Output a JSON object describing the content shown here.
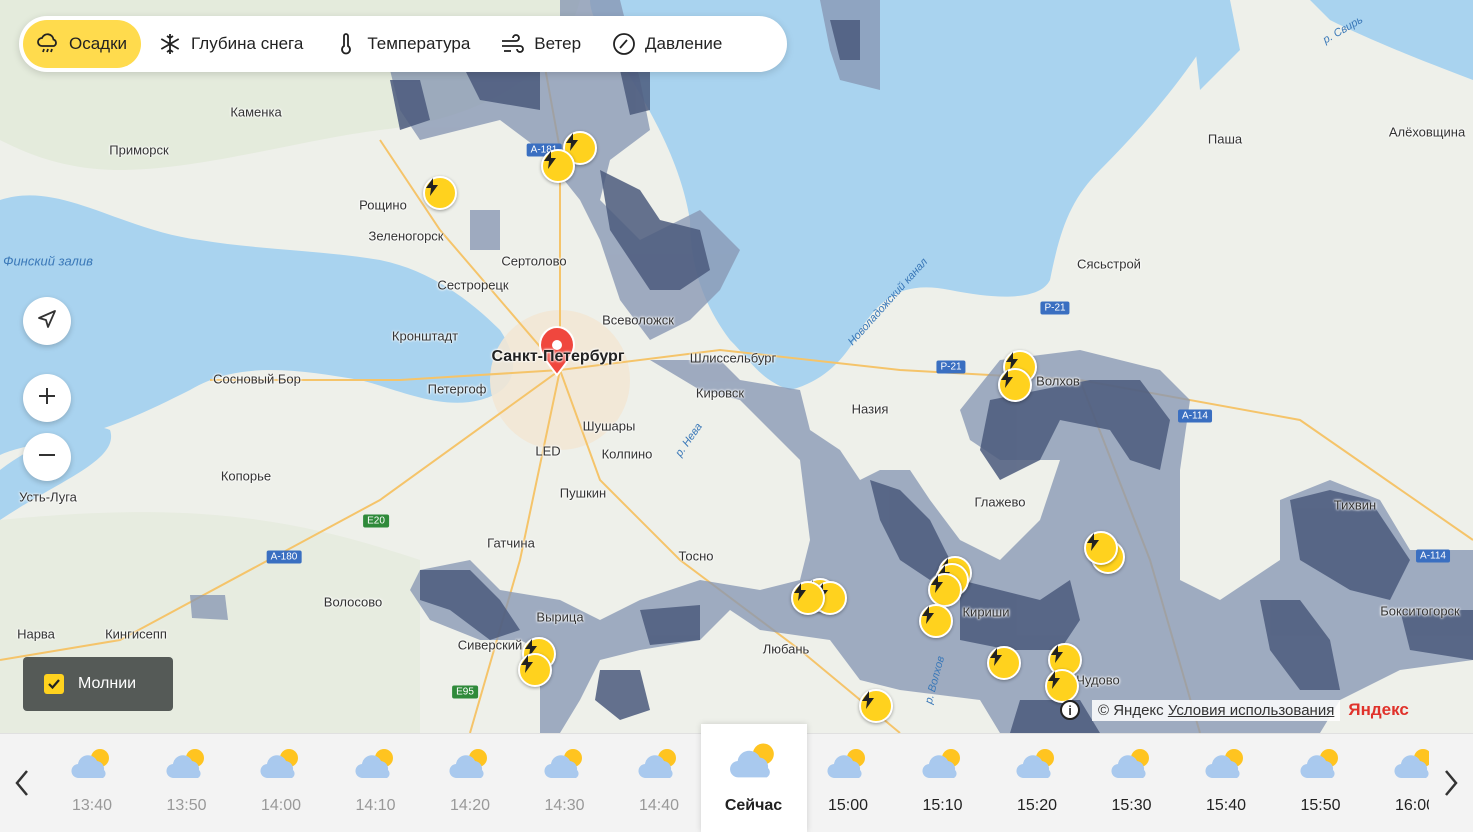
{
  "layers": [
    {
      "label": "Осадки",
      "icon": "rain-cloud-icon",
      "active": true
    },
    {
      "label": "Глубина снега",
      "icon": "snowflake-icon",
      "active": false
    },
    {
      "label": "Температура",
      "icon": "thermometer-icon",
      "active": false
    },
    {
      "label": "Ветер",
      "icon": "wind-icon",
      "active": false
    },
    {
      "label": "Давление",
      "icon": "pressure-gauge-icon",
      "active": false
    }
  ],
  "map_controls": {
    "locate": "navigation-arrow-icon",
    "zoom_in": "plus-icon",
    "zoom_out": "minus-icon"
  },
  "lightning_toggle": {
    "label": "Молнии",
    "checked": true
  },
  "attribution": {
    "copyright": "© Яндекс",
    "terms": "Условия использования",
    "logo": "Яндекс"
  },
  "map": {
    "places": [
      "Каменка",
      "Приморск",
      "Рощино",
      "Зеленогорск",
      "Сертолово",
      "Сестрорецк",
      "Всеволожск",
      "Кронштадт",
      "Санкт-Петербург",
      "Шлиссельбург",
      "Сосновый Бор",
      "Петергоф",
      "Кировск",
      "Шушары",
      "LED",
      "Колпино",
      "Пушкин",
      "Копорье",
      "Усть-Луга",
      "Гатчина",
      "Тосно",
      "Волосово",
      "Вырица",
      "Нарва",
      "Кингисепп",
      "Сиверский",
      "Любань",
      "Назия",
      "Глажево",
      "Кириши",
      "Паша",
      "Алёховщина",
      "Сясьстрой",
      "Тихвин",
      "Бокситогорск",
      "Волхов",
      "Финский залив",
      "Новоладожский канал",
      "р. Нева",
      "р. Волхов",
      "р. Свирь",
      "Чудово"
    ],
    "roads": [
      "А-181",
      "Р-21",
      "Р-21",
      "А-114",
      "А-114",
      "E20",
      "А-180",
      "E95"
    ],
    "marker": "location-pin-icon"
  },
  "timeline": {
    "prev_icon": "chevron-left-icon",
    "next_icon": "chevron-right-icon",
    "current_label": "Сейчас",
    "slots": [
      {
        "time": "13:40",
        "icon": "partly-cloudy-icon",
        "state": "past"
      },
      {
        "time": "13:50",
        "icon": "partly-cloudy-icon",
        "state": "past"
      },
      {
        "time": "14:00",
        "icon": "partly-cloudy-icon",
        "state": "past"
      },
      {
        "time": "14:10",
        "icon": "partly-cloudy-icon",
        "state": "past"
      },
      {
        "time": "14:20",
        "icon": "partly-cloudy-icon",
        "state": "past"
      },
      {
        "time": "14:30",
        "icon": "partly-cloudy-icon",
        "state": "past"
      },
      {
        "time": "14:40",
        "icon": "partly-cloudy-icon",
        "state": "past"
      },
      {
        "time": "Сейчас",
        "icon": "partly-cloudy-icon",
        "state": "current"
      },
      {
        "time": "15:00",
        "icon": "partly-cloudy-icon",
        "state": "future"
      },
      {
        "time": "15:10",
        "icon": "partly-cloudy-icon",
        "state": "future"
      },
      {
        "time": "15:20",
        "icon": "partly-cloudy-icon",
        "state": "future"
      },
      {
        "time": "15:30",
        "icon": "partly-cloudy-icon",
        "state": "future"
      },
      {
        "time": "15:40",
        "icon": "partly-cloudy-icon",
        "state": "future"
      },
      {
        "time": "15:50",
        "icon": "partly-cloudy-icon",
        "state": "future"
      },
      {
        "time": "16:00",
        "icon": "partly-cloudy-icon",
        "state": "future"
      }
    ]
  },
  "colors": {
    "accent": "#ffdb4d",
    "lightning": "#ffd21e",
    "water": "#a9d3ef",
    "precip_light": "#8897b4",
    "precip_heavy": "#4b5a7d"
  }
}
